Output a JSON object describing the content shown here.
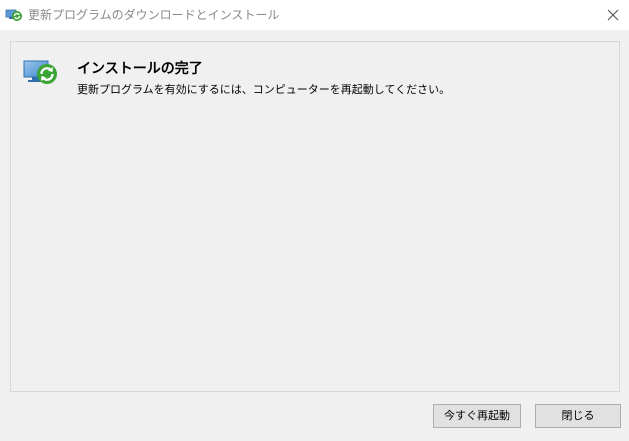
{
  "window": {
    "title": "更新プログラムのダウンロードとインストール",
    "close_icon": "close-icon",
    "title_icon": "windows-update-icon"
  },
  "panel": {
    "status_icon": "update-complete-icon",
    "heading": "インストールの完了",
    "message": "更新プログラムを有効にするには、コンピューターを再起動してください。"
  },
  "buttons": {
    "restart_now": "今すぐ再起動",
    "close": "閉じる"
  },
  "colors": {
    "background": "#f0f0f0",
    "titlebar": "#ffffff",
    "title_text": "#888888",
    "update_green": "#3aa535",
    "monitor_blue": "#5b9bd5"
  }
}
